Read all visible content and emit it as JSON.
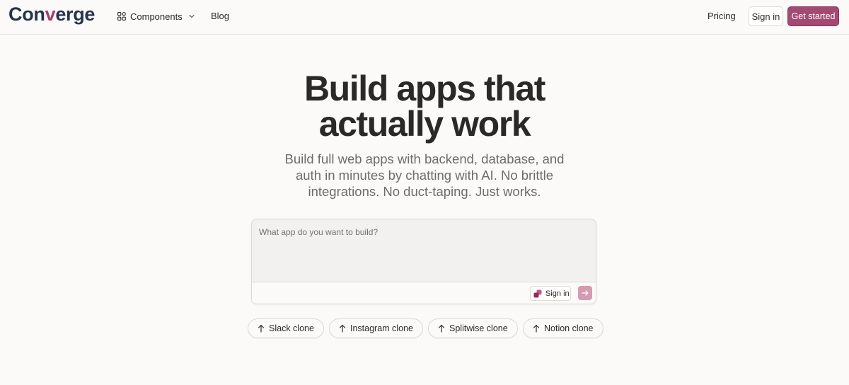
{
  "header": {
    "logo_prefix": "Con",
    "logo_accent": "v",
    "logo_suffix": "erge",
    "nav": {
      "components_label": "Components",
      "blog_label": "Blog",
      "pricing_label": "Pricing"
    },
    "sign_in_label": "Sign in",
    "get_started_label": "Get started"
  },
  "hero": {
    "title_line1": "Build apps that",
    "title_line2": "actually work",
    "subtitle": "Build full web apps with backend, database, and auth in minutes by chatting with AI. No brittle integrations. No duct-taping. Just works."
  },
  "prompt": {
    "placeholder": "What app do you want to build?",
    "value": "",
    "sign_in_label": "Sign in"
  },
  "suggestions": [
    {
      "label": "Slack clone"
    },
    {
      "label": "Instagram clone"
    },
    {
      "label": "Splitwise clone"
    },
    {
      "label": "Notion clone"
    }
  ],
  "colors": {
    "brand_navy": "#26334a",
    "accent": "#a63d6b",
    "primary_button": "#a34a72",
    "send_button": "#d49bb2",
    "background": "#fbfaf8"
  },
  "icons": {
    "components": "grid-icon",
    "dropdown": "chevron-down-icon",
    "prompt_sign_in": "brand-logo-icon",
    "send": "arrow-right-icon",
    "suggestion": "arrow-up-icon"
  }
}
